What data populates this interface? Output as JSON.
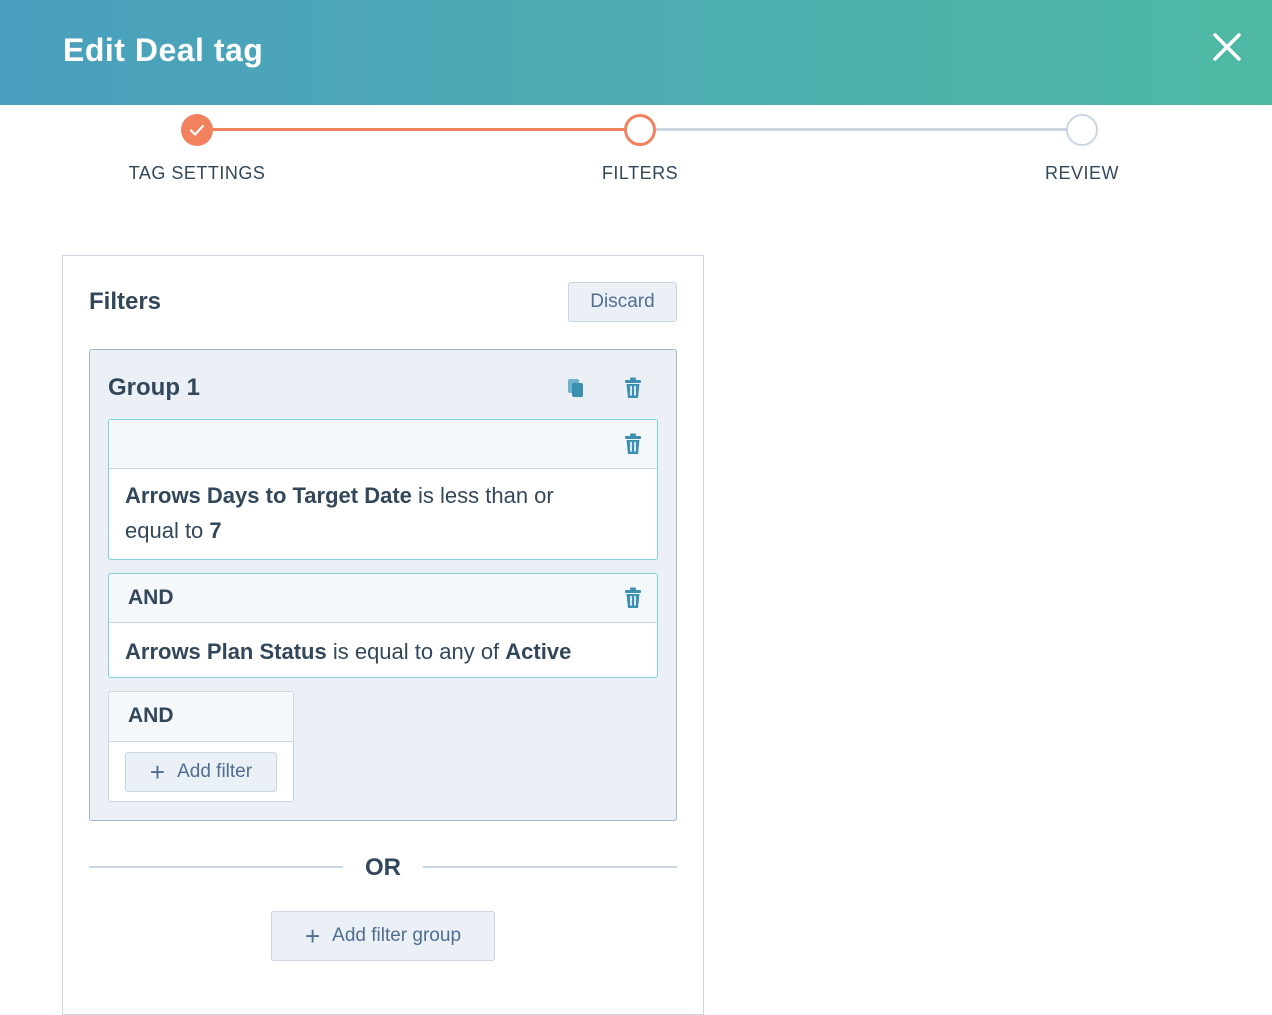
{
  "header": {
    "title": "Edit Deal tag"
  },
  "stepper": {
    "steps": [
      {
        "label": "TAG SETTINGS",
        "state": "complete"
      },
      {
        "label": "FILTERS",
        "state": "active"
      },
      {
        "label": "REVIEW",
        "state": "pending"
      }
    ]
  },
  "filters_panel": {
    "title": "Filters",
    "discard_label": "Discard",
    "group": {
      "title": "Group 1",
      "filters": [
        {
          "connector": "",
          "property": "Arrows Days to Target Date",
          "operator": " is less than or equal to ",
          "value": "7"
        },
        {
          "connector": "AND",
          "property": "Arrows Plan Status",
          "operator": " is equal to any of ",
          "value": "Active"
        }
      ],
      "add_connector": "AND",
      "add_filter_label": "Add filter"
    },
    "or_label": "OR",
    "add_filter_group_label": "Add filter group"
  },
  "colors": {
    "accent_orange": "#f2815e",
    "header_start": "#4a9fbe",
    "header_end": "#4fb9a4",
    "icon_teal": "#3d8fb0",
    "text": "#33475b"
  },
  "icons": {
    "close": "close-icon",
    "check": "check-icon",
    "copy": "copy-icon",
    "trash": "trash-icon",
    "plus": "plus-icon"
  }
}
